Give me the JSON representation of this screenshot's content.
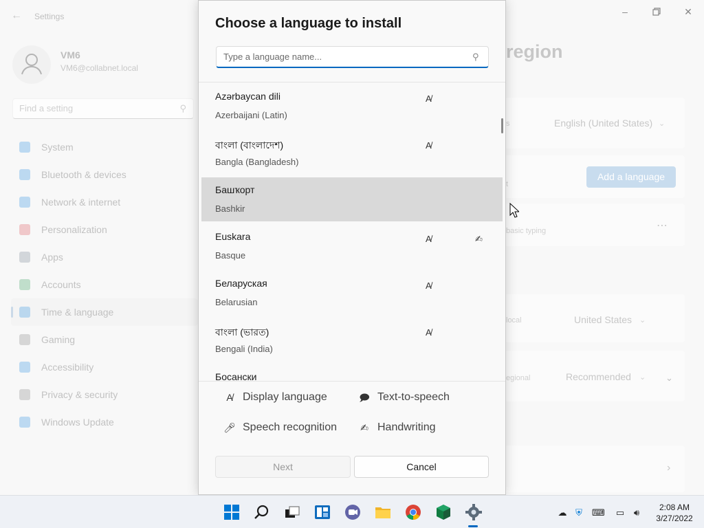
{
  "settings_window": {
    "app_title": "Settings",
    "user": {
      "name": "VM6",
      "email": "VM6@collabnet.local"
    },
    "search_placeholder": "Find a setting",
    "nav": [
      {
        "label": "System",
        "icon": "system-icon",
        "color": "#0078d4"
      },
      {
        "label": "Bluetooth & devices",
        "icon": "bluetooth-icon",
        "color": "#0078d4"
      },
      {
        "label": "Network & internet",
        "icon": "wifi-icon",
        "color": "#0078d4"
      },
      {
        "label": "Personalization",
        "icon": "brush-icon",
        "color": "#d13438"
      },
      {
        "label": "Apps",
        "icon": "apps-icon",
        "color": "#5c6b7a"
      },
      {
        "label": "Accounts",
        "icon": "accounts-icon",
        "color": "#10893e"
      },
      {
        "label": "Time & language",
        "icon": "time-language-icon",
        "color": "#0078d4",
        "active": true
      },
      {
        "label": "Gaming",
        "icon": "gaming-icon",
        "color": "#6b6b6b"
      },
      {
        "label": "Accessibility",
        "icon": "accessibility-icon",
        "color": "#0078d4"
      },
      {
        "label": "Privacy & security",
        "icon": "shield-icon",
        "color": "#6b6b6b"
      },
      {
        "label": "Windows Update",
        "icon": "update-icon",
        "color": "#0078d4"
      }
    ],
    "page_heading_partial": "region",
    "background_cards": {
      "lang_label_partial": "s",
      "display_language_value": "English (United States)",
      "add_language_button": "Add a language",
      "pref_label_partial": "t",
      "typing_label_partial": "basic typing",
      "region_label_partial": "local",
      "region_value": "United States",
      "regional_format_label_partial": "egional",
      "regional_format_value": "Recommended"
    }
  },
  "dialog": {
    "title": "Choose a language to install",
    "search_placeholder": "Type a language name...",
    "languages": [
      {
        "native": "Azərbaycan dili",
        "english": "Azerbaijani (Latin)",
        "display": true,
        "handwriting": false
      },
      {
        "native": "বাংলা (বাংলাদেশ)",
        "english": "Bangla (Bangladesh)",
        "display": true,
        "handwriting": false
      },
      {
        "native": "Башҡорт",
        "english": "Bashkir",
        "display": false,
        "handwriting": false,
        "hovered": true
      },
      {
        "native": "Euskara",
        "english": "Basque",
        "display": true,
        "handwriting": true
      },
      {
        "native": "Беларуская",
        "english": "Belarusian",
        "display": true,
        "handwriting": false
      },
      {
        "native": "বাংলা (ভারত)",
        "english": "Bengali (India)",
        "display": true,
        "handwriting": false
      },
      {
        "native": "Босански",
        "english": "",
        "display": false,
        "handwriting": false
      }
    ],
    "legend": {
      "display_language": "Display language",
      "text_to_speech": "Text-to-speech",
      "speech_recognition": "Speech recognition",
      "handwriting": "Handwriting"
    },
    "buttons": {
      "next": "Next",
      "cancel": "Cancel"
    }
  },
  "taskbar": {
    "apps": [
      "start-icon",
      "search-icon",
      "task-view-icon",
      "widgets-icon",
      "teams-chat-icon",
      "file-explorer-icon",
      "chrome-icon",
      "cube-app-icon",
      "settings-gear-icon"
    ],
    "clock": {
      "time": "2:08 AM",
      "date": "3/27/2022"
    }
  }
}
